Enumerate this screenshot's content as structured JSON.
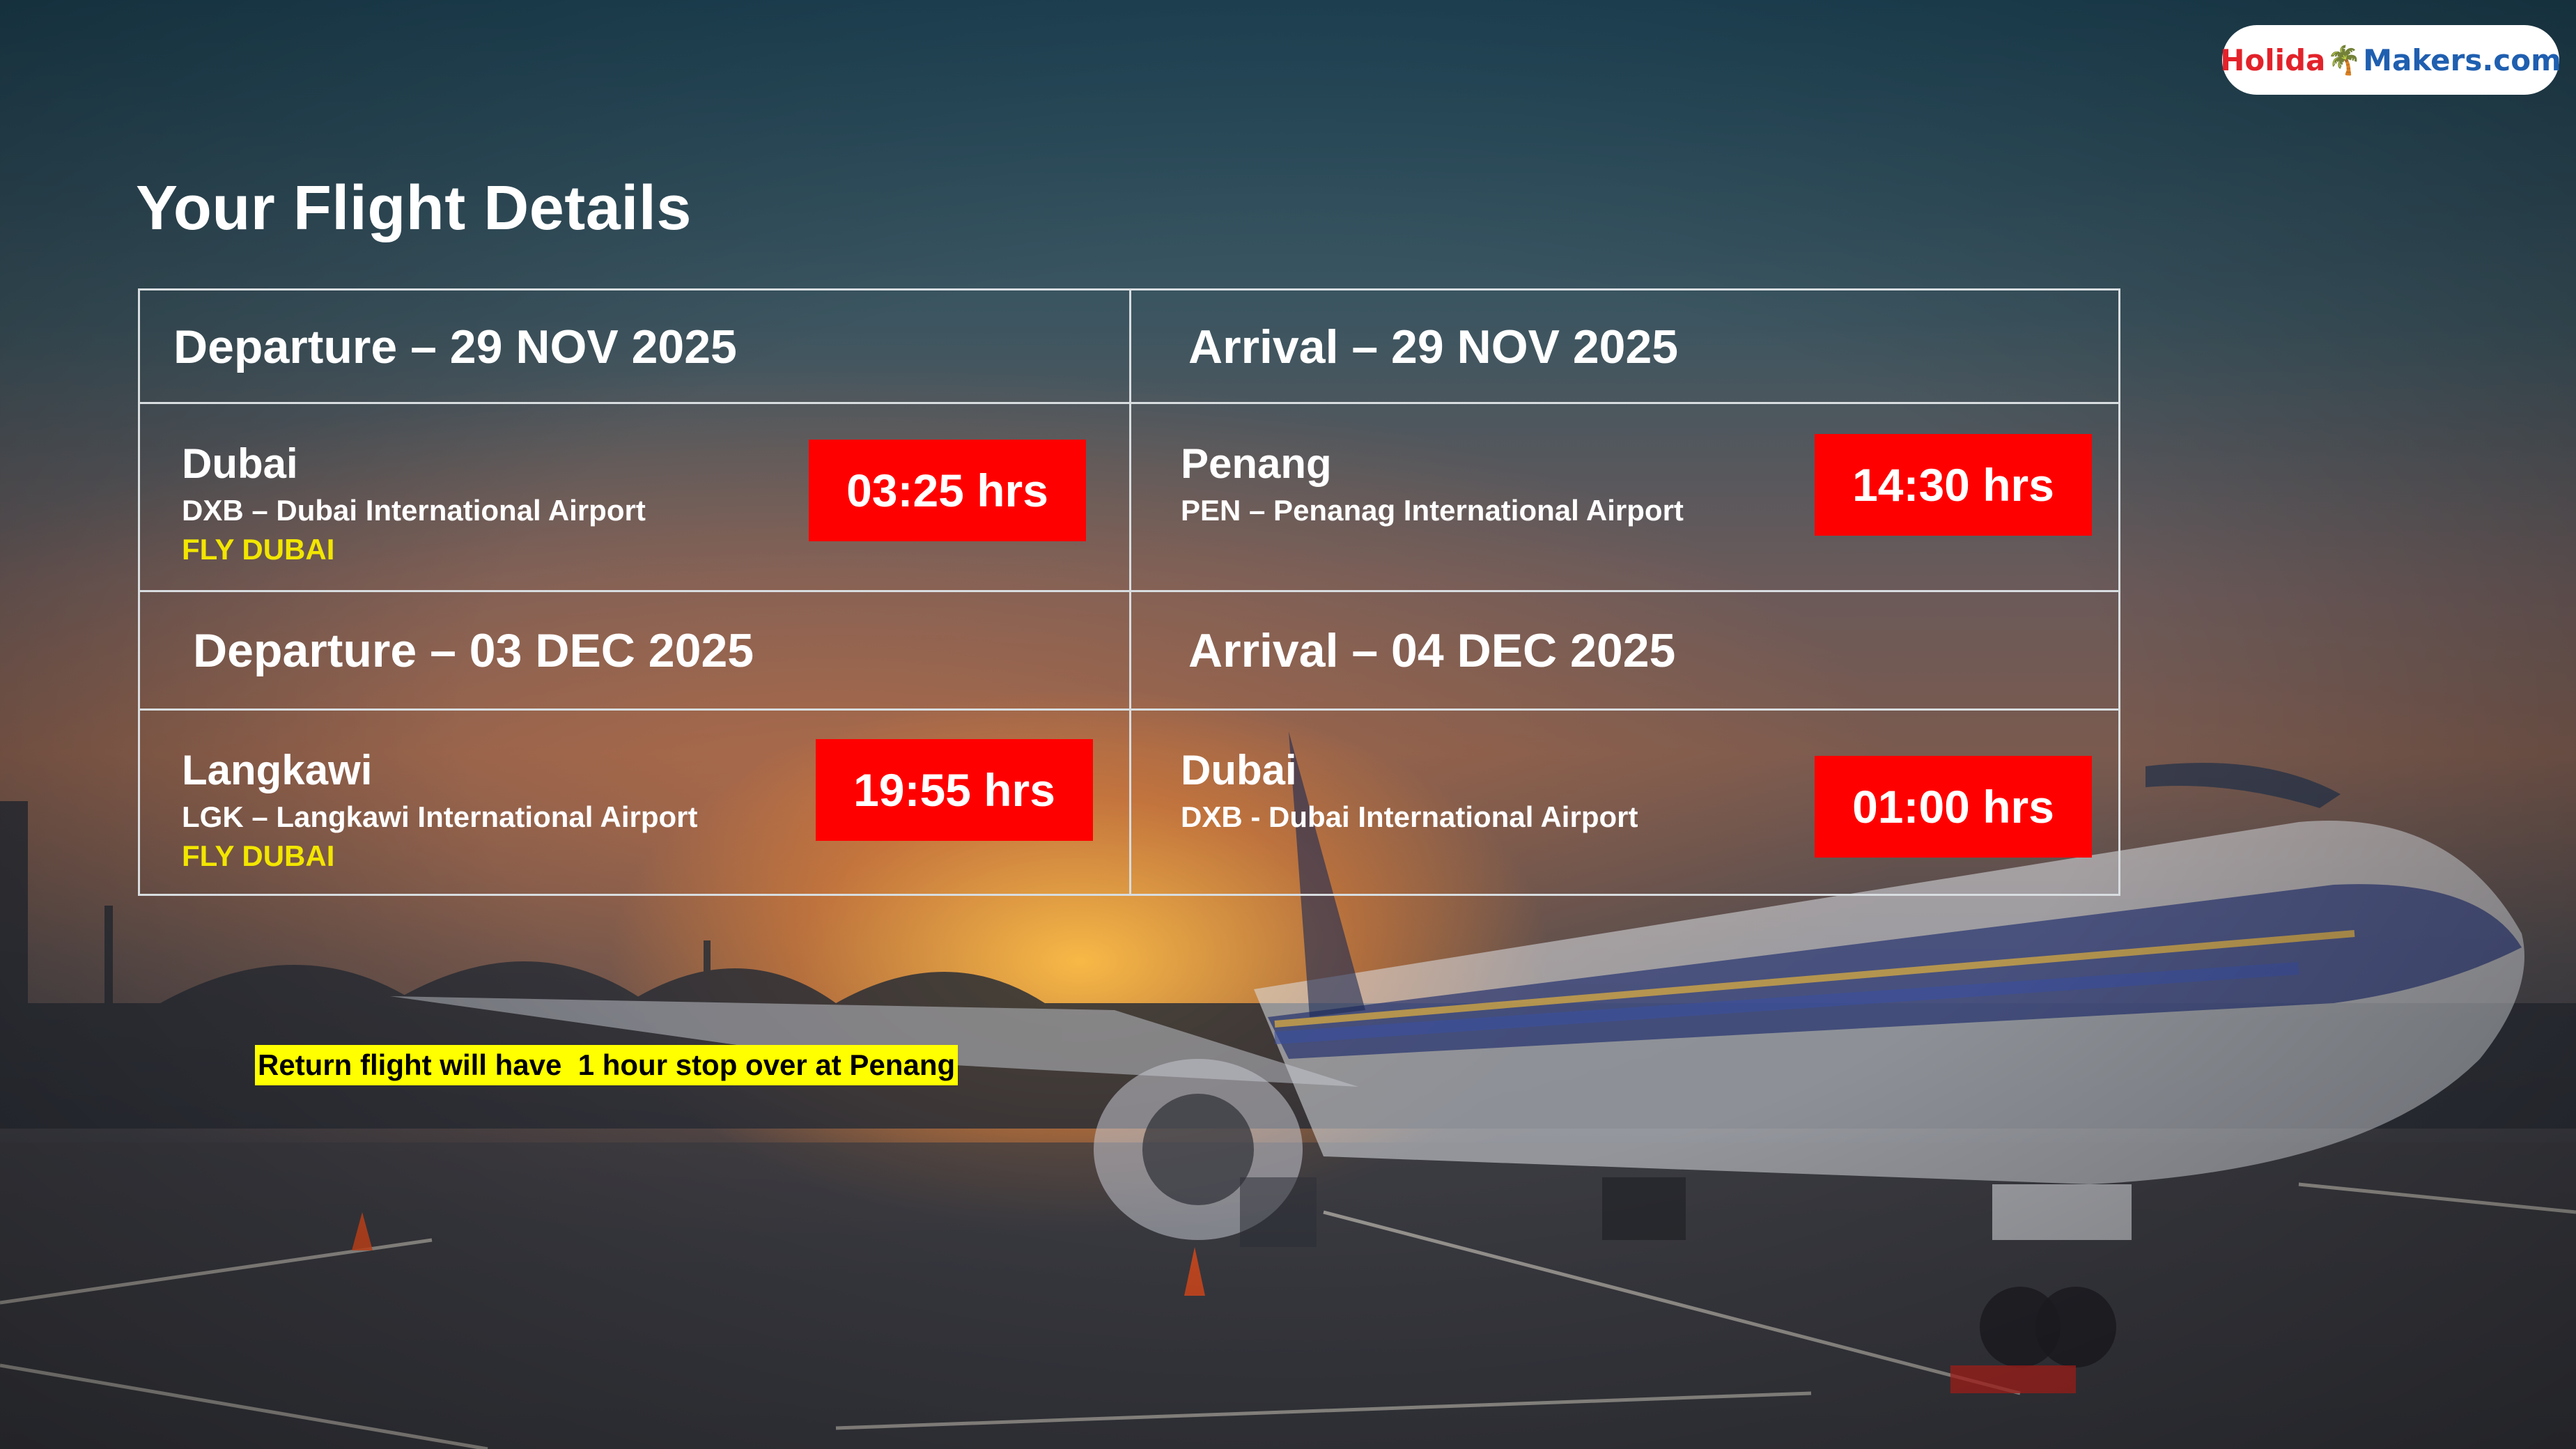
{
  "logo": {
    "part1": "Holida",
    "part2": "Makers.com",
    "icon": "palm-tree-icon"
  },
  "title": "Your Flight Details",
  "outbound": {
    "departure_header": "Departure – 29 NOV 2025",
    "arrival_header": "Arrival – 29 NOV 2025",
    "departure": {
      "city": "Dubai",
      "airport": "DXB – Dubai International Airport",
      "airline": "FLY DUBAI",
      "time": "03:25 hrs"
    },
    "arrival": {
      "city": "Penang",
      "airport": "PEN – Penanag International Airport",
      "time": "14:30 hrs"
    }
  },
  "return": {
    "departure_header": "Departure – 03 DEC 2025",
    "arrival_header": "Arrival – 04 DEC 2025",
    "departure": {
      "city": "Langkawi",
      "airport": "LGK – Langkawi International Airport",
      "airline": "FLY DUBAI",
      "time": "19:55 hrs"
    },
    "arrival": {
      "city": "Dubai",
      "airport": "DXB - Dubai International Airport",
      "time": "01:00 hrs"
    }
  },
  "note": "Return flight will have  1 hour stop over at Penang",
  "colors": {
    "badge": "#ff0000",
    "airline": "#f2e600",
    "note_bg": "#ffff00"
  }
}
